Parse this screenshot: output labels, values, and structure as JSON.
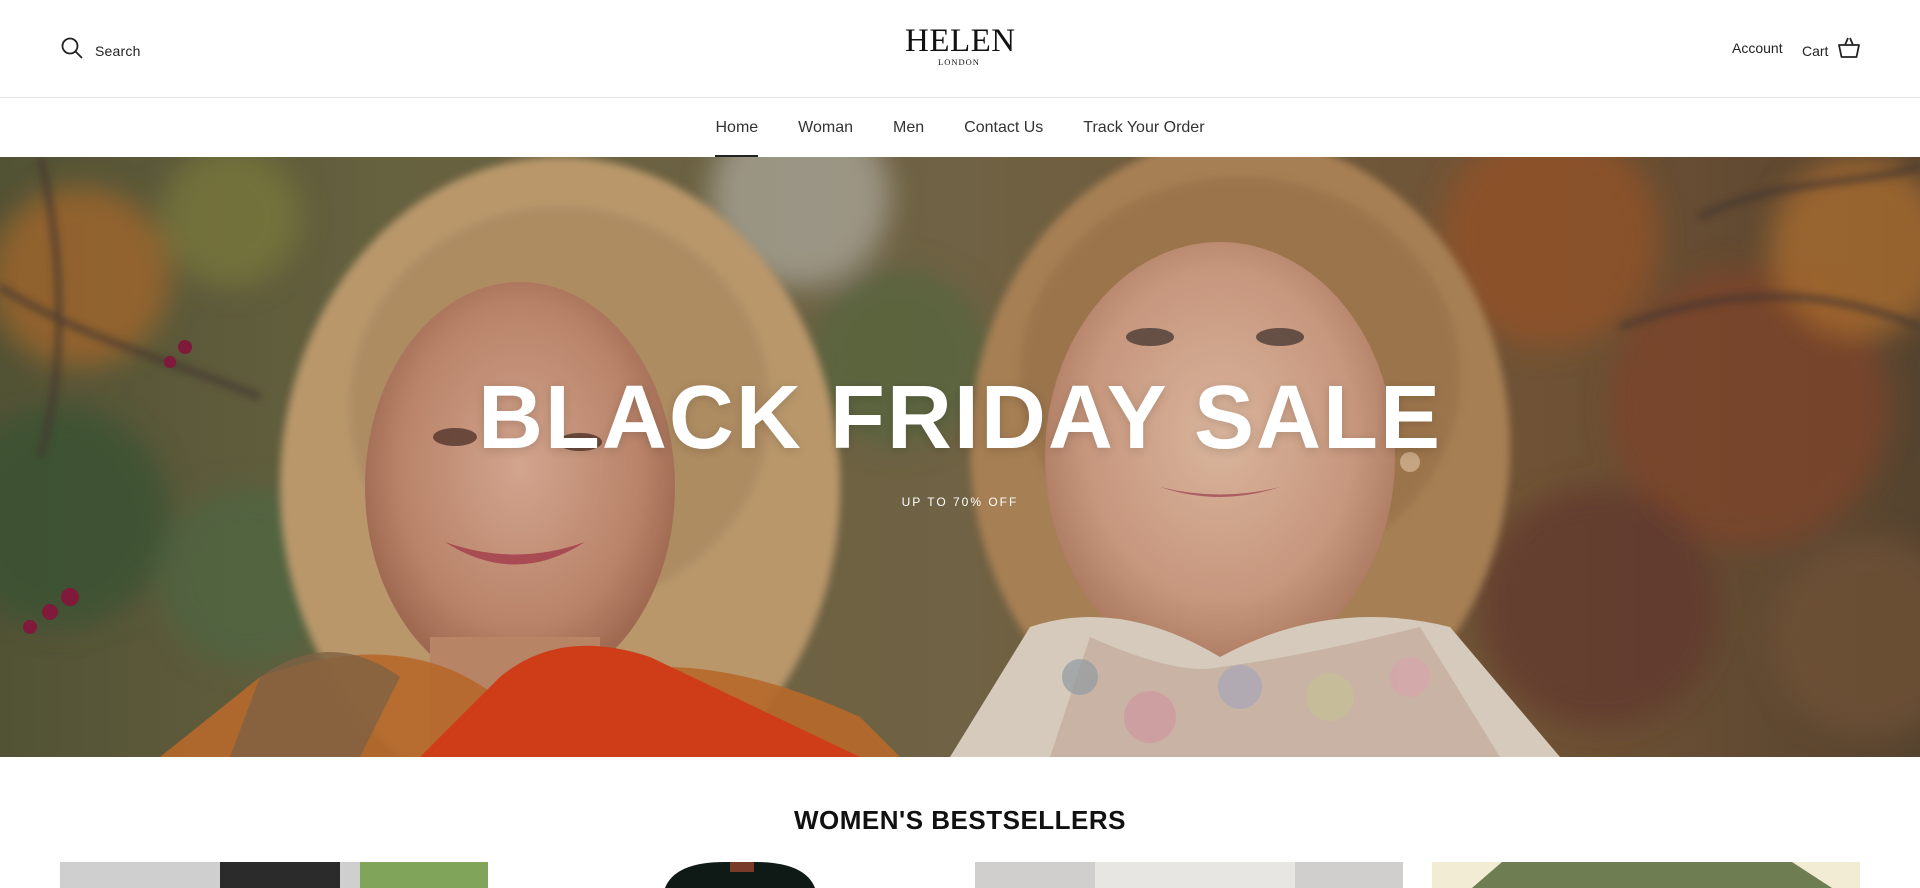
{
  "header": {
    "search_label": "Search",
    "logo_main": "HELEN",
    "logo_sub": "LONDON",
    "account_label": "Account",
    "cart_label": "Cart"
  },
  "nav": {
    "items": [
      {
        "label": "Home",
        "active": true
      },
      {
        "label": "Woman",
        "active": false
      },
      {
        "label": "Men",
        "active": false
      },
      {
        "label": "Contact Us",
        "active": false
      },
      {
        "label": "Track Your Order",
        "active": false
      }
    ]
  },
  "hero": {
    "title": "BLACK FRIDAY SALE",
    "subtitle": "UP TO 70% OFF"
  },
  "bestsellers": {
    "title": "WOMEN'S BESTSELLERS"
  },
  "icons": {
    "search": "search-icon",
    "cart": "cart-icon"
  },
  "colors": {
    "text": "#222222",
    "hero_text": "#ffffff",
    "divider": "#e6e6e6"
  }
}
